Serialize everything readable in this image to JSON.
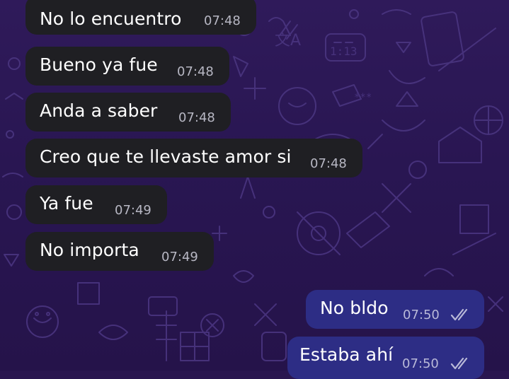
{
  "theme": {
    "wallpaper": "#2a1650",
    "incoming_bubble": "#1f1f23",
    "outgoing_bubble": "#2d2d85",
    "text": "#ffffff",
    "timestamp": "#b7b7c3"
  },
  "messages": [
    {
      "direction": "incoming",
      "text": "No lo encuentro",
      "time": "07:48"
    },
    {
      "direction": "incoming",
      "text": "Bueno ya fue",
      "time": "07:48"
    },
    {
      "direction": "incoming",
      "text": "Anda a saber",
      "time": "07:48"
    },
    {
      "direction": "incoming",
      "text": "Creo que te llevaste amor si",
      "time": "07:48"
    },
    {
      "direction": "incoming",
      "text": "Ya fue",
      "time": "07:49"
    },
    {
      "direction": "incoming",
      "text": "No importa",
      "time": "07:49"
    },
    {
      "direction": "outgoing",
      "text": "No bldo",
      "time": "07:50",
      "status_icon": "double-check-read-icon"
    },
    {
      "direction": "outgoing",
      "text": "Estaba ahí",
      "time": "07:50",
      "status_icon": "double-check-read-icon"
    }
  ]
}
